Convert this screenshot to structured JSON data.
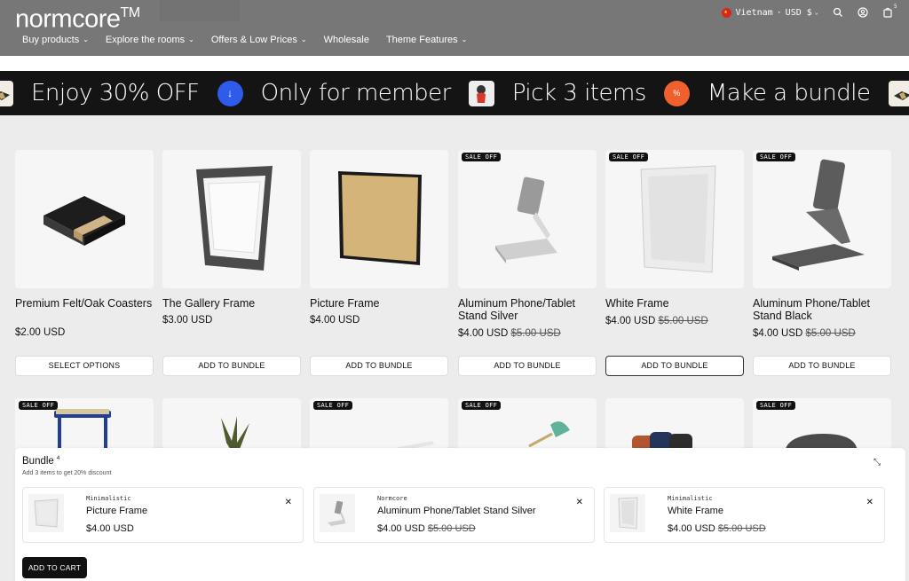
{
  "header": {
    "logo": "normcore",
    "logo_tm": "TM",
    "nav": [
      {
        "label": "Buy products",
        "has_dropdown": true
      },
      {
        "label": "Explore the rooms",
        "has_dropdown": true
      },
      {
        "label": "Offers & Low Prices",
        "has_dropdown": true
      },
      {
        "label": "Wholesale",
        "has_dropdown": false
      },
      {
        "label": "Theme Features",
        "has_dropdown": true
      }
    ],
    "country": "Vietnam",
    "currency": "USD $",
    "cart_count": "5",
    "icons": [
      "vietnam-flag-icon",
      "search-icon",
      "account-icon",
      "cart-icon"
    ]
  },
  "ticker": {
    "items": [
      {
        "text": "Enjoy 30% OFF",
        "icon": "arrow-down-icon",
        "icon_color": "#2f5bea"
      },
      {
        "text": "Only for member",
        "icon": "figurine-thumbnail"
      },
      {
        "text": "Pick 3 items",
        "icon": "percent-icon",
        "icon_color": "#f0602e"
      },
      {
        "text": "Make a bundle",
        "icon": "coaster-thumbnail"
      },
      {
        "text": "En",
        "icon": ""
      }
    ]
  },
  "products": [
    {
      "name": "Premium Felt/Oak Coasters",
      "price": "$2.00 USD",
      "compare": "",
      "sale": false,
      "button": "SELECT OPTIONS"
    },
    {
      "name": "The Gallery Frame",
      "price": "$3.00 USD",
      "compare": "",
      "sale": false,
      "button": "ADD TO BUNDLE"
    },
    {
      "name": "Picture Frame",
      "price": "$4.00 USD",
      "compare": "",
      "sale": false,
      "button": "ADD TO BUNDLE"
    },
    {
      "name": "Aluminum Phone/Tablet Stand Silver",
      "price": "$4.00 USD",
      "compare": "$5.00 USD",
      "sale": true,
      "button": "ADD TO BUNDLE"
    },
    {
      "name": "White Frame",
      "price": "$4.00 USD",
      "compare": "$5.00 USD",
      "sale": true,
      "button": "ADD TO BUNDLE"
    },
    {
      "name": "Aluminum Phone/Tablet Stand Black",
      "price": "$4.00 USD",
      "compare": "$5.00 USD",
      "sale": true,
      "button": "ADD TO BUNDLE"
    }
  ],
  "sale_badge": "SALE OFF",
  "row2_sale": [
    true,
    false,
    true,
    true,
    false,
    true
  ],
  "bundle": {
    "title": "Bundle",
    "count": "4",
    "subtitle": "Add 3 items to get 20% discount",
    "items": [
      {
        "vendor": "Minimalistic",
        "name": "Picture Frame",
        "price": "$4.00 USD",
        "compare": ""
      },
      {
        "vendor": "Normcore",
        "name": "Aluminum Phone/Tablet Stand Silver",
        "price": "$4.00 USD",
        "compare": "$5.00 USD"
      },
      {
        "vendor": "Minimalistic",
        "name": "White Frame",
        "price": "$4.00 USD",
        "compare": "$5.00 USD"
      }
    ],
    "cart_button": "ADD TO CART"
  }
}
